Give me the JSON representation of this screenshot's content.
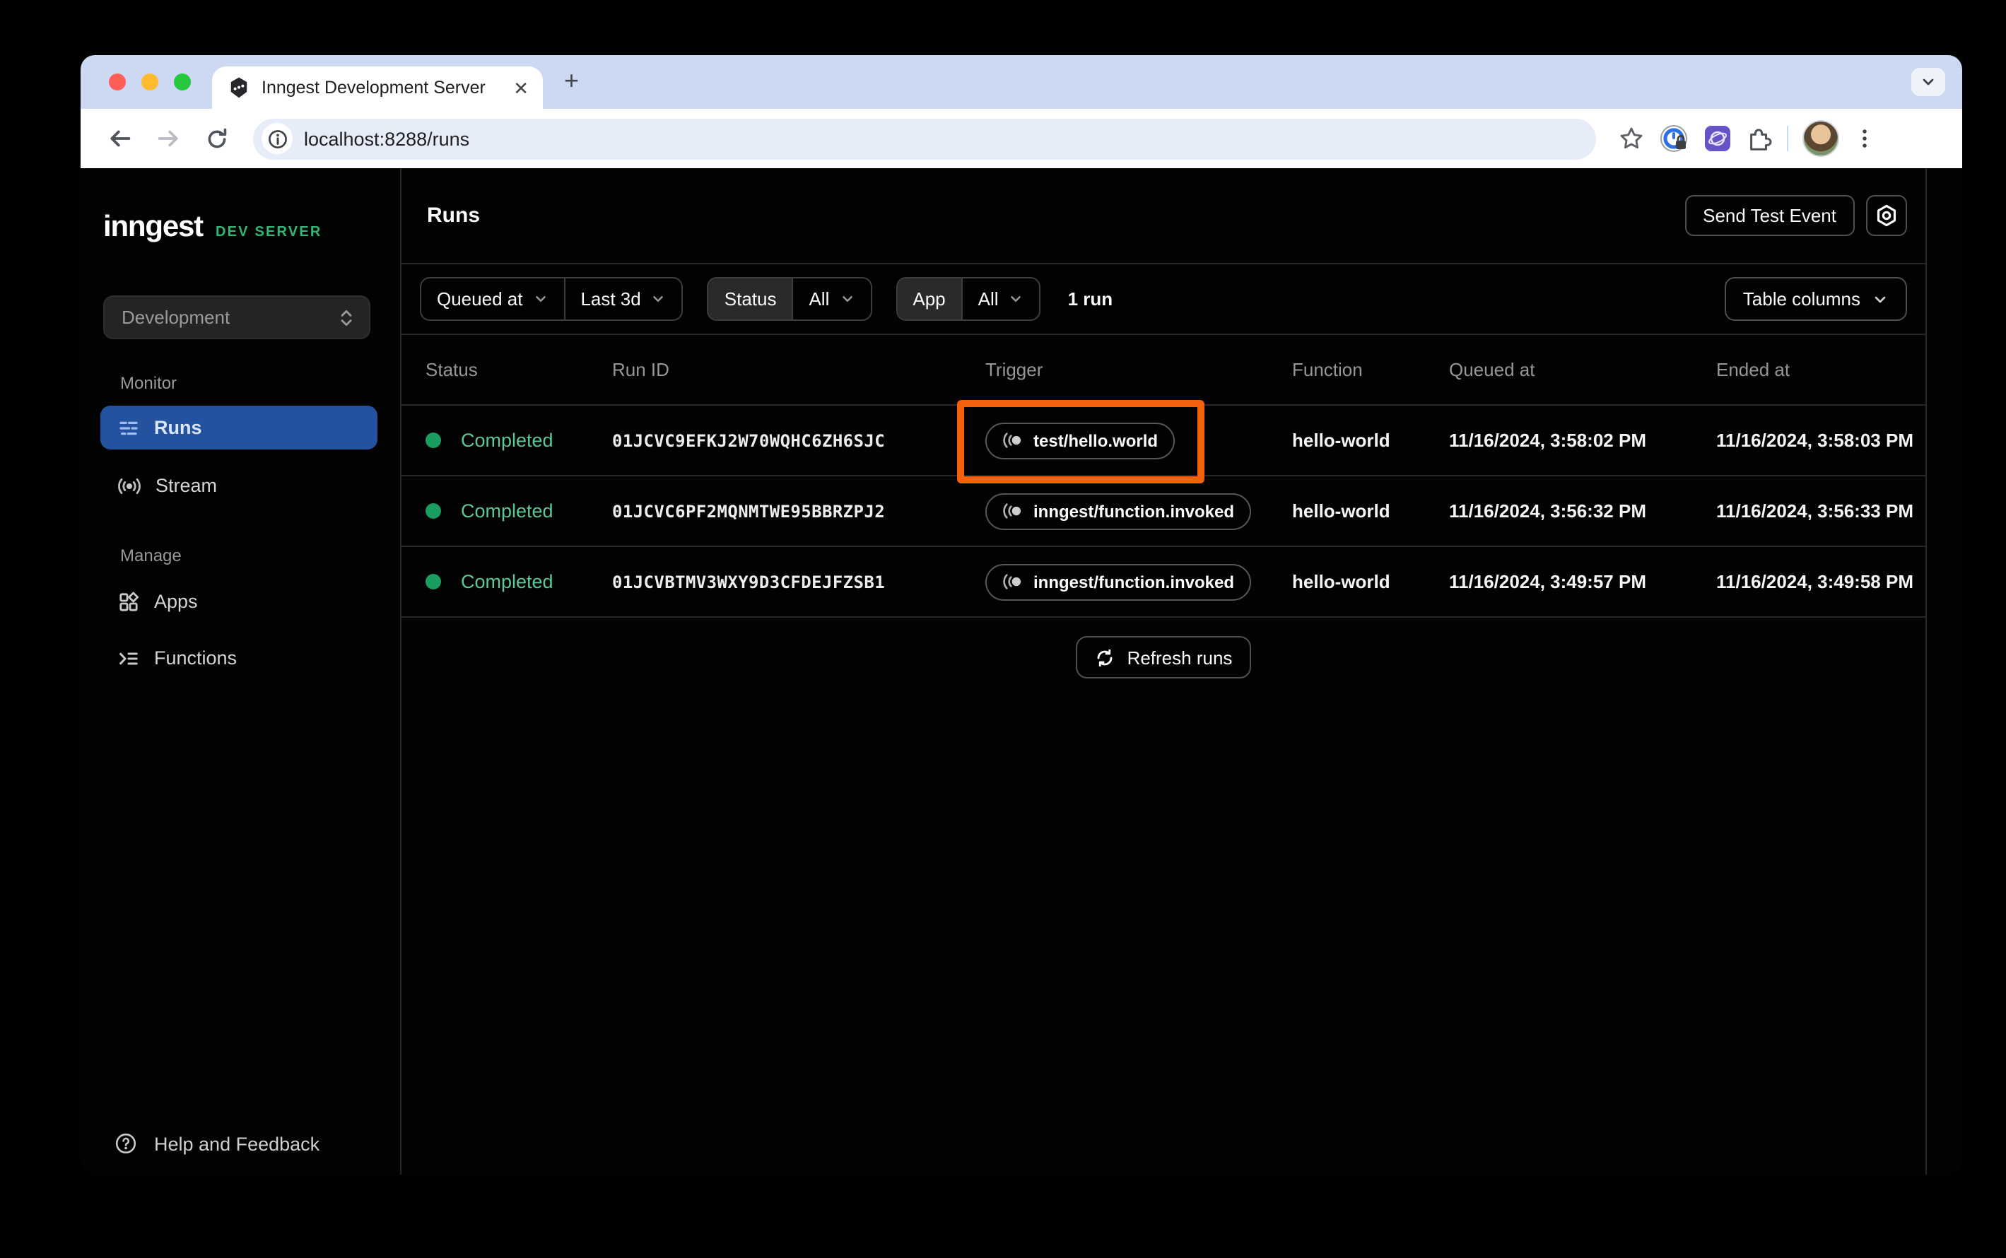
{
  "browser": {
    "tab_title": "Inngest Development Server",
    "url": "localhost:8288/runs"
  },
  "sidebar": {
    "logo": "inngest",
    "logo_badge": "DEV SERVER",
    "env_selector": "Development",
    "sections": [
      {
        "label": "Monitor",
        "items": [
          {
            "label": "Runs",
            "active": true
          },
          {
            "label": "Stream",
            "active": false
          }
        ]
      },
      {
        "label": "Manage",
        "items": [
          {
            "label": "Apps",
            "active": false
          },
          {
            "label": "Functions",
            "active": false
          }
        ]
      }
    ],
    "footer_label": "Help and Feedback"
  },
  "header": {
    "title": "Runs",
    "send_test_event": "Send Test Event"
  },
  "filters": {
    "queued_at_label": "Queued at",
    "range_value": "Last 3d",
    "status_label": "Status",
    "status_value": "All",
    "app_label": "App",
    "app_value": "All",
    "run_count": "1 run",
    "table_columns_label": "Table columns"
  },
  "table": {
    "headers": [
      "Status",
      "Run ID",
      "Trigger",
      "Function",
      "Queued at",
      "Ended at"
    ],
    "rows": [
      {
        "status": "Completed",
        "run_id": "01JCVC9EFKJ2W70WQHC6ZH6SJC",
        "trigger": "test/hello.world",
        "function": "hello-world",
        "queued_at": "11/16/2024, 3:58:02 PM",
        "ended_at": "11/16/2024, 3:58:03 PM",
        "highlighted": true
      },
      {
        "status": "Completed",
        "run_id": "01JCVC6PF2MQNMTWE95BBRZPJ2",
        "trigger": "inngest/function.invoked",
        "function": "hello-world",
        "queued_at": "11/16/2024, 3:56:32 PM",
        "ended_at": "11/16/2024, 3:56:33 PM",
        "highlighted": false
      },
      {
        "status": "Completed",
        "run_id": "01JCVBTMV3WXY9D3CFDEJFZSB1",
        "trigger": "inngest/function.invoked",
        "function": "hello-world",
        "queued_at": "11/16/2024, 3:49:57 PM",
        "ended_at": "11/16/2024, 3:49:58 PM",
        "highlighted": false
      }
    ],
    "refresh_label": "Refresh runs"
  },
  "colors": {
    "brand_green": "#2eb873",
    "status_green": "#5ec795",
    "active_blue": "#24529f",
    "highlight_orange": "#f5600d",
    "page_bg": "#020202"
  }
}
